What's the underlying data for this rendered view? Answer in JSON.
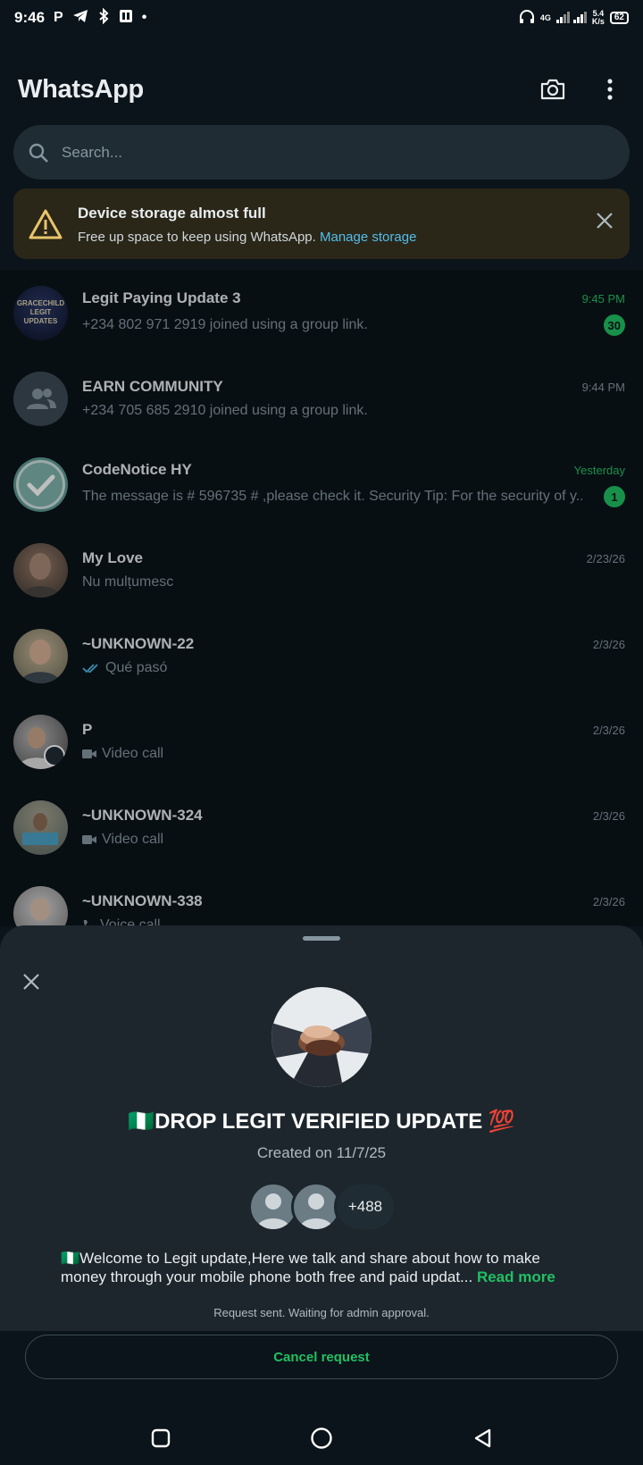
{
  "status_bar": {
    "time": "9:46",
    "network": "4G",
    "speed_top": "5.4",
    "speed_bottom": "K/s",
    "battery": "62"
  },
  "header": {
    "title": "WhatsApp",
    "icons": [
      "camera-icon",
      "more-options-icon"
    ]
  },
  "search": {
    "placeholder": "Search..."
  },
  "storage_banner": {
    "title": "Device storage almost full",
    "message": "Free up space to keep using WhatsApp.",
    "link": "Manage storage"
  },
  "chats": [
    {
      "name": "Legit Paying Update 3",
      "message": "+234 802 971 2919 joined using a group link.",
      "time": "9:45 PM",
      "unread": "30",
      "time_green": true
    },
    {
      "name": "EARN COMMUNITY",
      "message": "+234 705 685 2910 joined using a group link.",
      "time": "9:44 PM"
    },
    {
      "name": "CodeNotice HY",
      "message": "The message is # 596735 # ,please check it.  Security Tip: For the security of y...",
      "time": "Yesterday",
      "unread": "1",
      "time_green": true
    },
    {
      "name": "My Love",
      "message": "Nu mulțumesc",
      "time": "2/23/26"
    },
    {
      "name": "~UNKNOWN-22",
      "message": "Qué pasó",
      "time": "2/3/26"
    },
    {
      "name": "P",
      "message": "Video call",
      "time": "2/3/26"
    },
    {
      "name": "~UNKNOWN-324",
      "message": "Video call",
      "time": "2/3/26"
    },
    {
      "name": "~UNKNOWN-338",
      "message": "Voice call",
      "time": "2/3/26"
    }
  ],
  "avatar_text": {
    "gracechild_line1": "GRACECHILD",
    "gracechild_line2": "LEGIT UPDATES"
  },
  "group_sheet": {
    "name": "🇳🇬DROP LEGIT VERIFIED UPDATE 💯",
    "created": "Created on 11/7/25",
    "member_count": "+488",
    "description": "🇳🇬Welcome to Legit update,Here we talk and share about how to make money through your mobile phone both free and paid updat...",
    "read_more": "Read more",
    "status": "Request sent. Waiting for admin approval.",
    "cancel_label": "Cancel request"
  },
  "colors": {
    "background": "#0b141a",
    "accent_green": "#21c063",
    "link_blue": "#53bdeb",
    "banner_bg": "#2a2719",
    "sheet_bg": "#1d262d"
  }
}
